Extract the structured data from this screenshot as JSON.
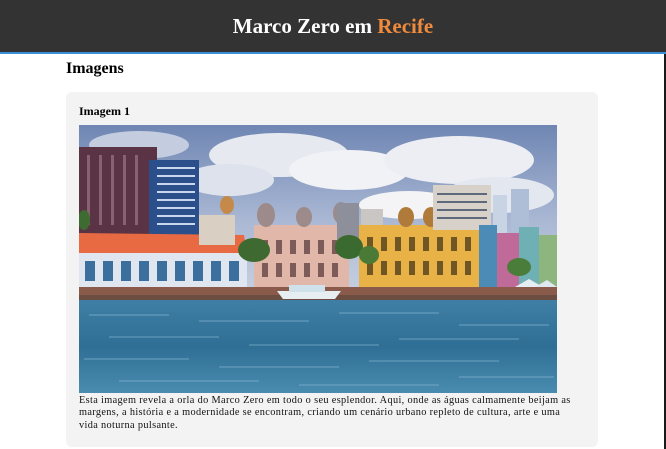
{
  "header": {
    "title_main": "Marco Zero em",
    "title_accent": "Recife",
    "accent_color": "#f08a3c",
    "background": "#333333"
  },
  "section": {
    "title": "Imagens"
  },
  "card": {
    "title": "Imagem 1",
    "image_icon": "photo-recife-waterfront",
    "caption": "Esta imagem revela a orla do Marco Zero em todo o seu esplendor. Aqui, onde as águas calmamente beijam as margens, a história e a modernidade se encontram, criando um cenário urbano repleto de cultura, arte e uma vida noturna pulsante."
  }
}
